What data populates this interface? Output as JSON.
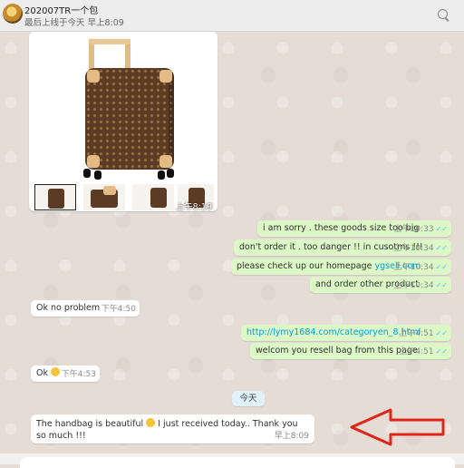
{
  "header": {
    "contact_name": "202007TR一个包",
    "status": "最后上线于今天 早上8:09",
    "search_icon": "search-icon"
  },
  "image_message": {
    "time": "上午8:19",
    "time_visible": "8:19",
    "overlay": "以上"
  },
  "messages_out": [
    {
      "text": "i am sorry . these goods size too big",
      "time": "上午10:33",
      "ticks": "✓✓"
    },
    {
      "text": "don't order it . too danger !! in cusotms !!!",
      "time": "上午10:34",
      "ticks": "✓✓"
    },
    {
      "text_prefix": "please check up our homepage ",
      "link": "ygsell.com",
      "time": "上午10:34",
      "ticks": "✓✓"
    },
    {
      "text": "and order other product",
      "time": "上午10:34",
      "ticks": "✓✓"
    },
    {
      "link": "http://lymy1684.com/categoryen_8.html",
      "time": "上午4:51",
      "ticks": "✓✓"
    },
    {
      "text": "welcom you resell bag  from this page",
      "time": "上午4:51",
      "ticks": "✓✓"
    }
  ],
  "messages_in": [
    {
      "text": "Ok no problem",
      "time": "下午4:50"
    },
    {
      "text": "Ok",
      "time": "下午4:53",
      "emoji": "smile-emoji"
    }
  ],
  "day_divider": "今天",
  "last_message": {
    "text_1": "The handbag is beautiful ",
    "text_2": " I just received today.. Thank you so much !!!",
    "time": "早上8:09",
    "emoji": "heart-eyes-emoji"
  },
  "annotation": {
    "color": "#e0261b",
    "shape": "left-arrow-outline"
  }
}
